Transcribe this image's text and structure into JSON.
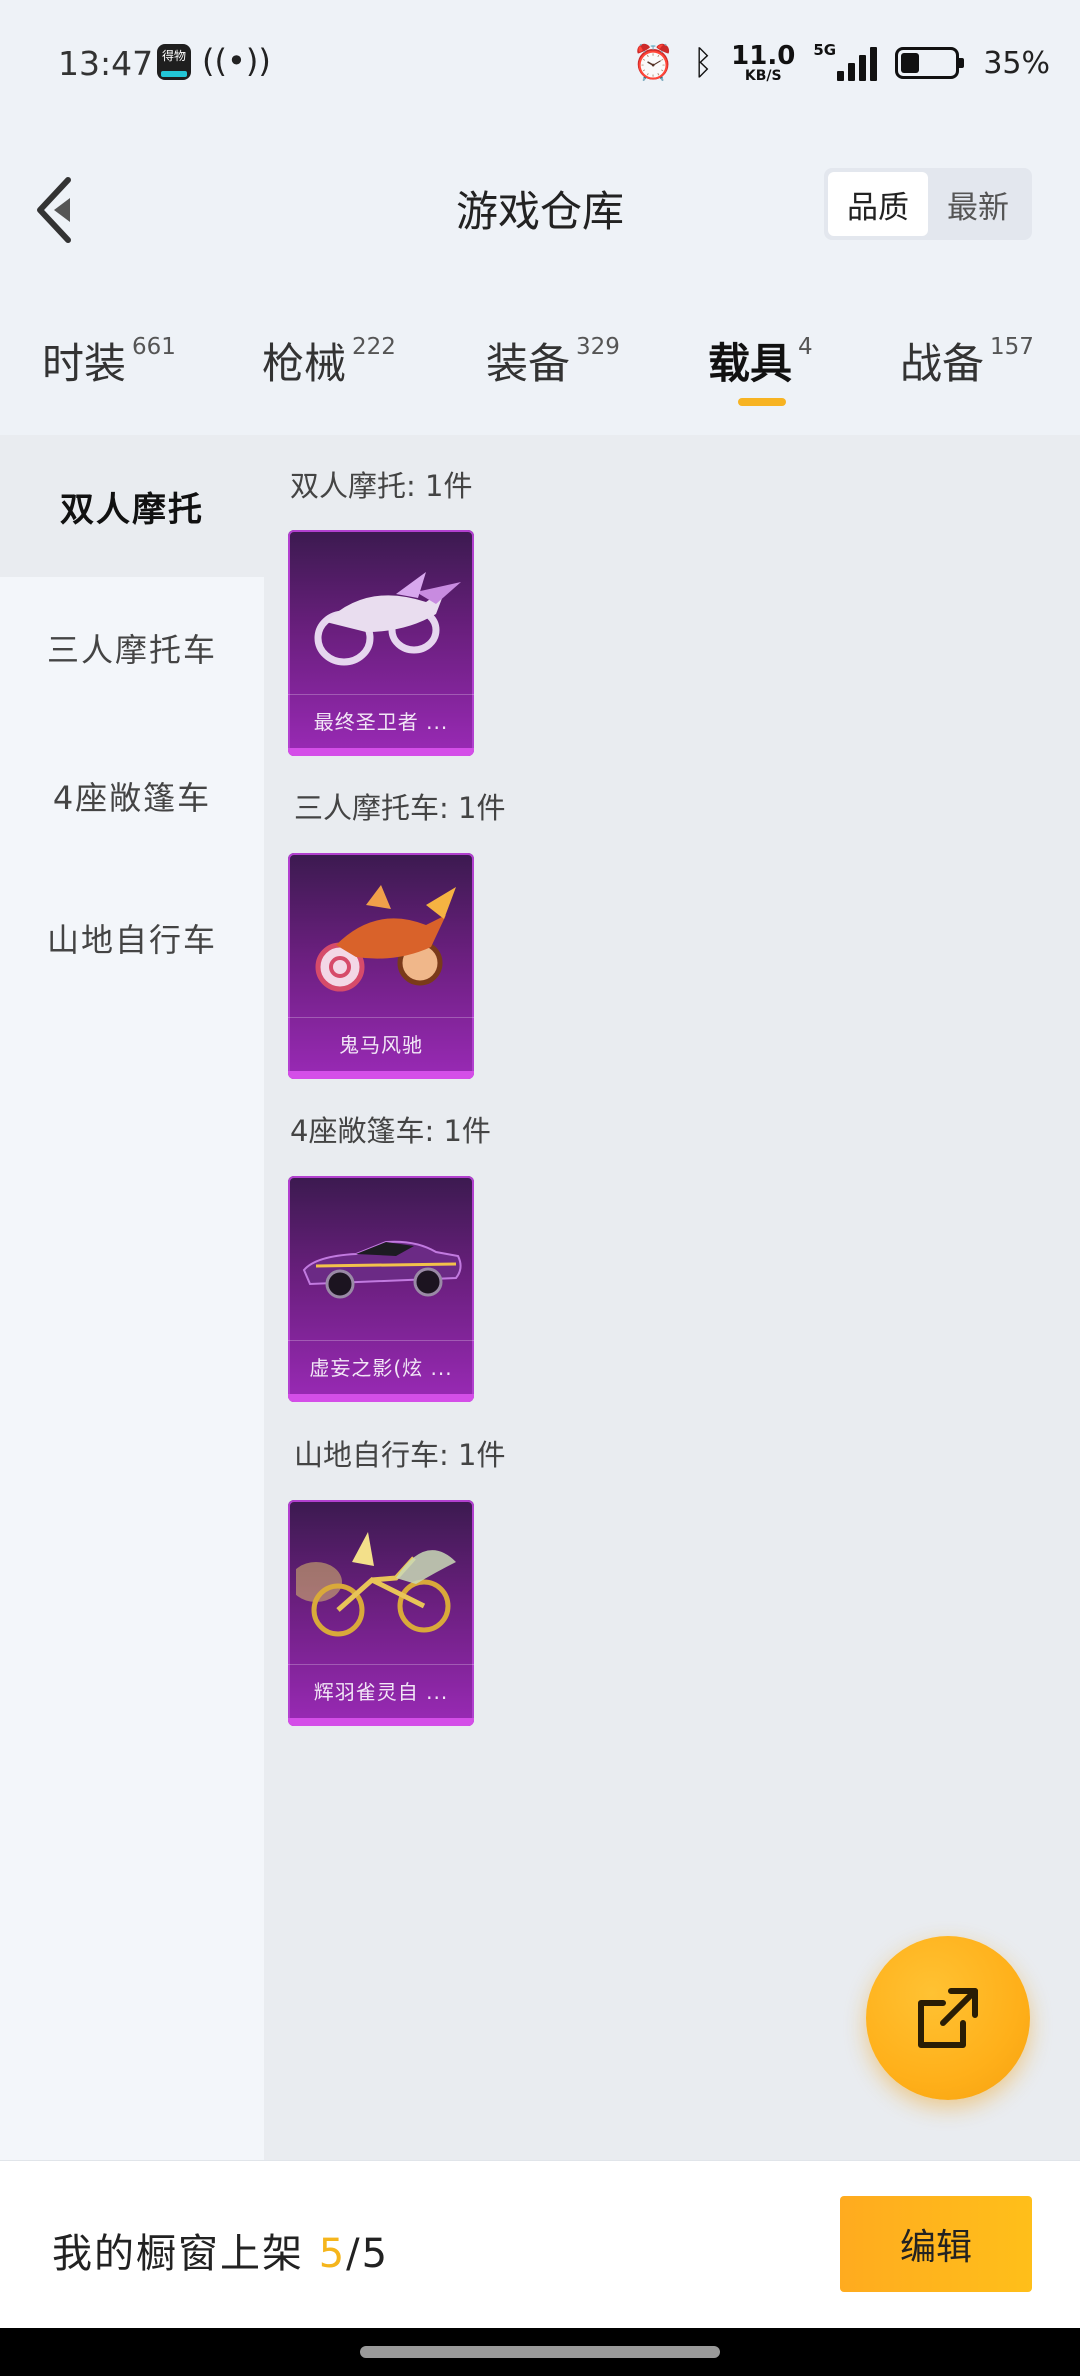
{
  "status_bar": {
    "time": "13:47",
    "app_icon": "得物",
    "hotspot_icon": "hotspot-icon",
    "speed_value": "11.0",
    "speed_unit": "KB/S",
    "network": "5G",
    "battery_level": 0.35,
    "battery_text": "35%"
  },
  "header": {
    "title": "游戏仓库",
    "sort_options": [
      "品质",
      "最新"
    ],
    "sort_selected": "品质"
  },
  "tabs": [
    {
      "label": "时装",
      "count": "661"
    },
    {
      "label": "枪械",
      "count": "222"
    },
    {
      "label": "装备",
      "count": "329"
    },
    {
      "label": "载具",
      "count": "4"
    },
    {
      "label": "战备",
      "count": "157"
    }
  ],
  "active_tab": "载具",
  "sidebar": {
    "items": [
      "双人摩托",
      "三人摩托车",
      "4座敞篷车",
      "山地自行车"
    ],
    "active": "双人摩托"
  },
  "sections": [
    {
      "title": "双人摩托: 1件",
      "item_name": "最终圣卫者 ..."
    },
    {
      "title": "三人摩托车: 1件",
      "item_name": "鬼马风驰"
    },
    {
      "title": "4座敞篷车: 1件",
      "item_name": "虚妄之影(炫 ..."
    },
    {
      "title": "山地自行车: 1件",
      "item_name": "辉羽雀灵自 ..."
    }
  ],
  "bottom_bar": {
    "showcase_prefix": "我的橱窗上架 ",
    "showcase_current": "5",
    "showcase_total": "/5",
    "edit_label": "编辑"
  },
  "colors": {
    "accent": "#f7b322",
    "card_purple": "#9a2ab6",
    "background": "#eef2f7"
  },
  "icons": {
    "back": "chevron-left-icon",
    "fab": "share-external-icon",
    "alarm": "alarm-icon",
    "bluetooth": "bluetooth-icon",
    "signal": "signal-icon",
    "battery": "battery-icon"
  }
}
